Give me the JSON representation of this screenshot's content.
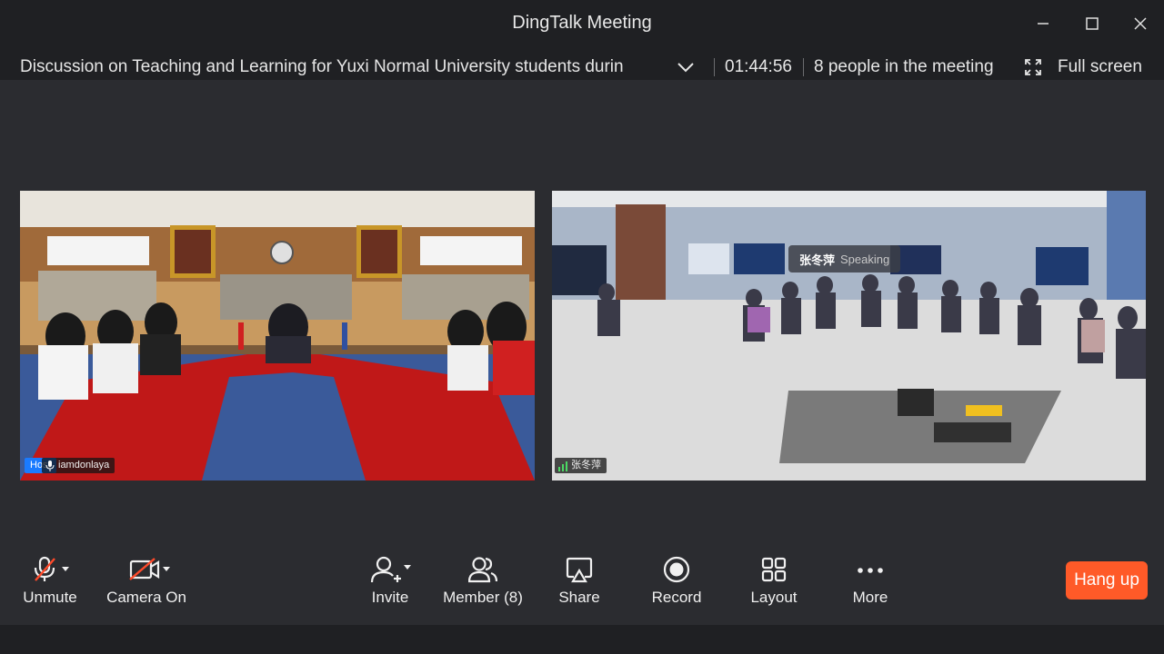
{
  "window": {
    "title": "DingTalk Meeting"
  },
  "meeting": {
    "title": "Discussion on Teaching and Learning for Yuxi Normal University students durin",
    "elapsed": "01:44:56",
    "participants": "8 people in the meeting",
    "fullscreen_label": "Full screen"
  },
  "videos": {
    "left": {
      "host_badge": "Host",
      "name": "iamdonlaya"
    },
    "right": {
      "name": "张冬萍",
      "speaking_name": "张冬萍",
      "speaking_status": "Speaking"
    }
  },
  "toolbar": {
    "unmute": "Unmute",
    "camera": "Camera On",
    "invite": "Invite",
    "member": "Member (8)",
    "share": "Share",
    "record": "Record",
    "layout": "Layout",
    "more": "More",
    "hangup": "Hang up"
  },
  "colors": {
    "accent_blue": "#1a7bff",
    "hangup": "#ff5a28",
    "background": "#2b2c30"
  }
}
